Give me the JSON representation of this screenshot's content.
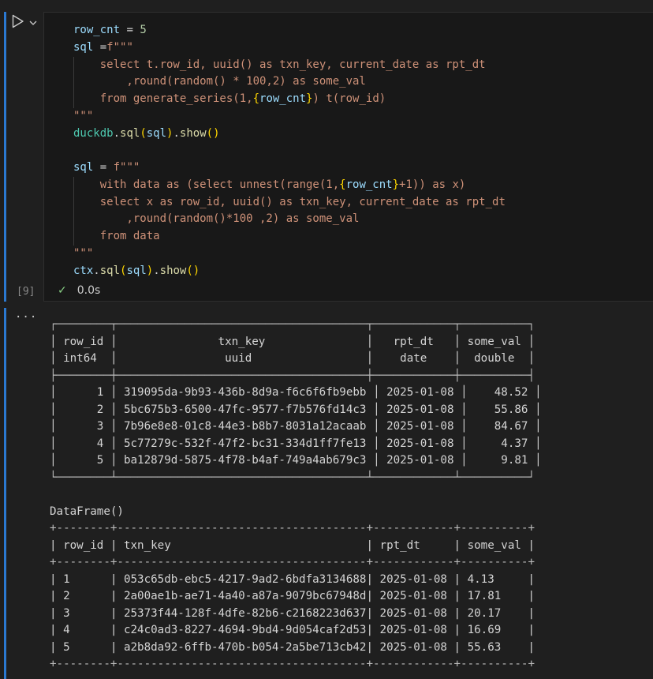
{
  "cell": {
    "execution_count": "[9]",
    "status_time": "0.0s",
    "code_lines": [
      {
        "indent": 0,
        "tokens": [
          {
            "t": "row_cnt",
            "c": "var"
          },
          {
            "t": " = ",
            "c": "op"
          },
          {
            "t": "5",
            "c": "num"
          }
        ]
      },
      {
        "indent": 0,
        "tokens": [
          {
            "t": "sql",
            "c": "var"
          },
          {
            "t": " =",
            "c": "op"
          },
          {
            "t": "f\"\"\"",
            "c": "str"
          }
        ]
      },
      {
        "indent": 1,
        "tokens": [
          {
            "t": "    select t.row_id, uuid() as txn_key, current_date as rpt_dt",
            "c": "str"
          }
        ]
      },
      {
        "indent": 1,
        "tokens": [
          {
            "t": "        ,round(random() * 100,2) as some_val",
            "c": "str"
          }
        ]
      },
      {
        "indent": 1,
        "tokens": [
          {
            "t": "    from generate_series(1,",
            "c": "str"
          },
          {
            "t": "{",
            "c": "brace"
          },
          {
            "t": "row_cnt",
            "c": "var"
          },
          {
            "t": "}",
            "c": "brace"
          },
          {
            "t": ") t(row_id)",
            "c": "str"
          }
        ]
      },
      {
        "indent": 0,
        "tokens": [
          {
            "t": "\"\"\"",
            "c": "str"
          }
        ]
      },
      {
        "indent": 0,
        "tokens": [
          {
            "t": "duckdb",
            "c": "fn"
          },
          {
            "t": ".",
            "c": "op"
          },
          {
            "t": "sql",
            "c": "call"
          },
          {
            "t": "(",
            "c": "brace"
          },
          {
            "t": "sql",
            "c": "var"
          },
          {
            "t": ")",
            "c": "brace"
          },
          {
            "t": ".",
            "c": "op"
          },
          {
            "t": "show",
            "c": "call"
          },
          {
            "t": "()",
            "c": "brace"
          }
        ]
      },
      {
        "indent": 0,
        "tokens": []
      },
      {
        "indent": 0,
        "tokens": [
          {
            "t": "sql",
            "c": "var"
          },
          {
            "t": " = ",
            "c": "op"
          },
          {
            "t": "f\"\"\"",
            "c": "str"
          }
        ]
      },
      {
        "indent": 1,
        "tokens": [
          {
            "t": "    with data as (select unnest(range(1,",
            "c": "str"
          },
          {
            "t": "{",
            "c": "brace"
          },
          {
            "t": "row_cnt",
            "c": "var"
          },
          {
            "t": "}",
            "c": "brace"
          },
          {
            "t": "+1)) as x)",
            "c": "str"
          }
        ]
      },
      {
        "indent": 1,
        "tokens": [
          {
            "t": "    select x as row_id, uuid() as txn_key, current_date as rpt_dt",
            "c": "str"
          }
        ]
      },
      {
        "indent": 1,
        "tokens": [
          {
            "t": "        ,round(random()*100 ,2) as some_val",
            "c": "str"
          }
        ]
      },
      {
        "indent": 1,
        "tokens": [
          {
            "t": "    from data",
            "c": "str"
          }
        ]
      },
      {
        "indent": 0,
        "tokens": [
          {
            "t": "\"\"\"",
            "c": "str"
          }
        ]
      },
      {
        "indent": 0,
        "tokens": [
          {
            "t": "ctx",
            "c": "var"
          },
          {
            "t": ".",
            "c": "op"
          },
          {
            "t": "sql",
            "c": "call"
          },
          {
            "t": "(",
            "c": "brace"
          },
          {
            "t": "sql",
            "c": "var"
          },
          {
            "t": ")",
            "c": "brace"
          },
          {
            "t": ".",
            "c": "op"
          },
          {
            "t": "show",
            "c": "call"
          },
          {
            "t": "()",
            "c": "brace"
          }
        ]
      }
    ]
  },
  "output": {
    "ellipsis": "···",
    "duckdb_table": {
      "columns": [
        {
          "name": "row_id",
          "type": "int64"
        },
        {
          "name": "txn_key",
          "type": "uuid"
        },
        {
          "name": "rpt_dt",
          "type": "date"
        },
        {
          "name": "some_val",
          "type": "double"
        }
      ],
      "rows": [
        [
          "1",
          "319095da-9b93-436b-8d9a-f6c6f6fb9ebb",
          "2025-01-08",
          "48.52"
        ],
        [
          "2",
          "5bc675b3-6500-47fc-9577-f7b576fd14c3",
          "2025-01-08",
          "55.86"
        ],
        [
          "3",
          "7b96e8e8-01c8-44e3-b8b7-8031a12acaab",
          "2025-01-08",
          "84.67"
        ],
        [
          "4",
          "5c77279c-532f-47f2-bc31-334d1ff7fe13",
          "2025-01-08",
          "4.37"
        ],
        [
          "5",
          "ba12879d-5875-4f78-b4af-749a4ab679c3",
          "2025-01-08",
          "9.81"
        ]
      ]
    },
    "dataframe_label": "DataFrame()",
    "dataframe_table": {
      "columns": [
        "row_id",
        "txn_key",
        "rpt_dt",
        "some_val"
      ],
      "rows": [
        [
          "1",
          "053c65db-ebc5-4217-9ad2-6bdfa3134688",
          "2025-01-08",
          "4.13"
        ],
        [
          "2",
          "2a00ae1b-ae71-4a40-a87a-9079bc67948d",
          "2025-01-08",
          "17.81"
        ],
        [
          "3",
          "25373f44-128f-4dfe-82b6-c2168223d637",
          "2025-01-08",
          "20.17"
        ],
        [
          "4",
          "c24c0ad3-8227-4694-9bd4-9d054caf2d53",
          "2025-01-08",
          "16.69"
        ],
        [
          "5",
          "a2b8da92-6ffb-470b-b054-2a5be713cb42",
          "2025-01-08",
          "55.63"
        ]
      ]
    }
  }
}
